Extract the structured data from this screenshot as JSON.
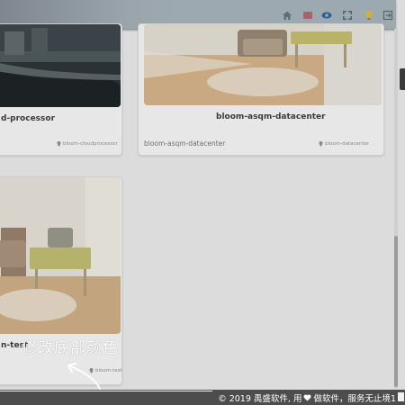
{
  "toolbar": {
    "icons": [
      "home-icon",
      "flag-icon",
      "eye-icon",
      "expand-icon",
      "bulb-icon",
      "exit-icon"
    ]
  },
  "cards": [
    {
      "title": "d-processor",
      "subtitle": "",
      "location": "bloom-cloudprocessor"
    },
    {
      "title": "bloom-asqm-datacenter",
      "subtitle": "bloom-asqm-datacenter",
      "location": "bloom-datacenter"
    },
    {
      "title": "n-test",
      "subtitle": "",
      "location": "bloom-test"
    }
  ],
  "annotation": {
    "text": "修改底部颜色"
  },
  "footer": {
    "prefix": "© 2019 禹盛软件, 用",
    "suffix": "做软件，服务无止境1",
    "heart_color": "#ffffff"
  },
  "colors": {
    "overlay": "#8e8e8e",
    "footer_bg": "#4d4d4d",
    "toolbar_bg": "#9da9b1"
  }
}
